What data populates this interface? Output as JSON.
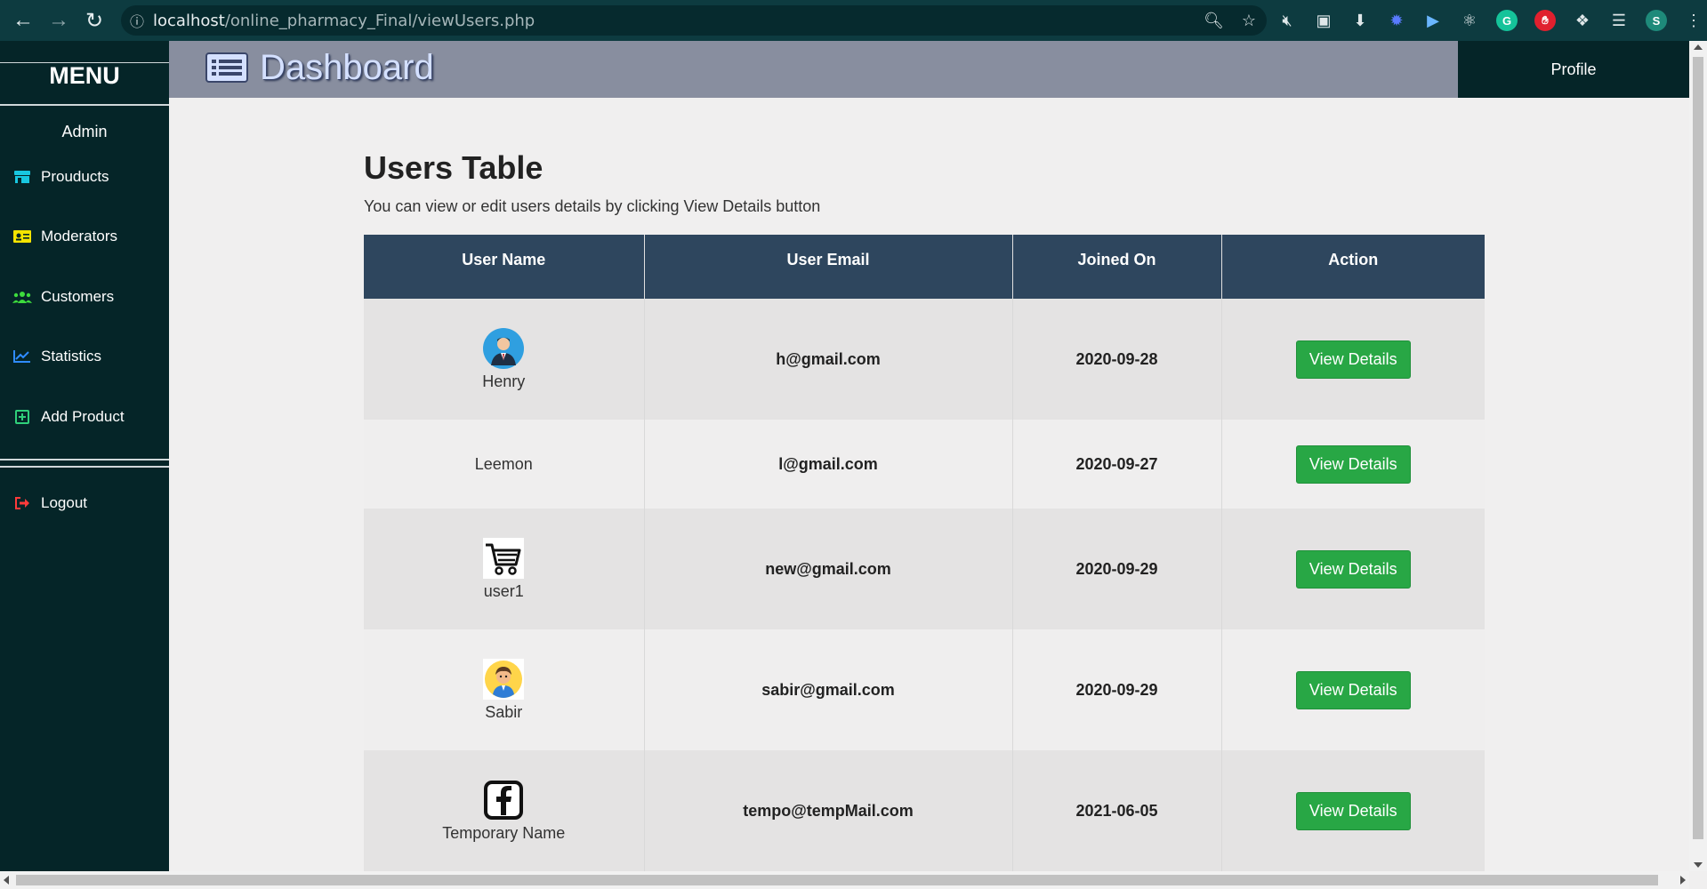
{
  "browser": {
    "url_host": "localhost",
    "url_path": "/online_pharmacy_Final/viewUsers.php",
    "profile_initial": "S"
  },
  "sidebar": {
    "menu_title": "MENU",
    "role_label": "Admin",
    "items": [
      {
        "label": "Prouducts",
        "icon": "store-icon",
        "color": "#18c7e0"
      },
      {
        "label": "Moderators",
        "icon": "id-card-icon",
        "color": "#f5e400"
      },
      {
        "label": "Customers",
        "icon": "users-icon",
        "color": "#3ddc3d"
      },
      {
        "label": "Statistics",
        "icon": "chart-line-icon",
        "color": "#2f8cff"
      },
      {
        "label": "Add Product",
        "icon": "plus-square-icon",
        "color": "#2fd07a"
      }
    ],
    "logout_label": "Logout",
    "logout_icon_color": "#ff3b3b"
  },
  "header": {
    "title": "Dashboard",
    "profile_label": "Profile"
  },
  "main": {
    "title": "Users Table",
    "subtitle": "You can view or edit users details by clicking View Details button",
    "columns": [
      "User Name",
      "User Email",
      "Joined On",
      "Action"
    ],
    "rows": [
      {
        "name": "Henry",
        "email": "h@gmail.com",
        "joined": "2020-09-28",
        "action": "View Details",
        "avatar": "businessman-avatar-icon"
      },
      {
        "name": "Leemon",
        "email": "l@gmail.com",
        "joined": "2020-09-27",
        "action": "View Details",
        "avatar": "none"
      },
      {
        "name": "user1",
        "email": "new@gmail.com",
        "joined": "2020-09-29",
        "action": "View Details",
        "avatar": "shopping-cart-icon"
      },
      {
        "name": "Sabir",
        "email": "sabir@gmail.com",
        "joined": "2020-09-29",
        "action": "View Details",
        "avatar": "man-avatar-icon"
      },
      {
        "name": "Temporary Name",
        "email": "tempo@tempMail.com",
        "joined": "2021-06-05",
        "action": "View Details",
        "avatar": "facebook-icon"
      }
    ]
  },
  "colors": {
    "sidebar_bg": "#052528",
    "header_bg": "#888e9f",
    "table_header_bg": "#2e465e",
    "button_green": "#28a745"
  }
}
